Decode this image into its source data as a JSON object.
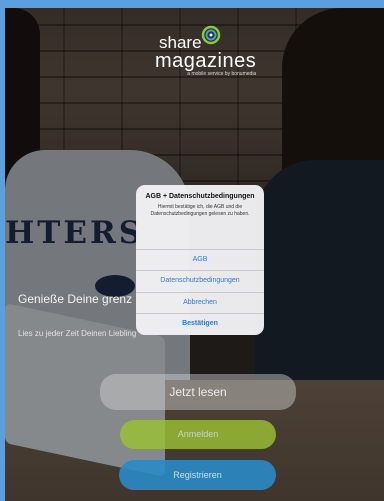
{
  "app": {
    "logo_share": "share",
    "logo_magazines": "magazines",
    "logo_sub": "a mobile service by bonumedia"
  },
  "background": {
    "tagline": "Genieße Deine grenz",
    "subline": "Lies zu jeder Zeit Deinen Liebling",
    "shirt_print": "HTERS"
  },
  "buttons": {
    "read_now": "Jetzt lesen",
    "login": "Anmelden",
    "register": "Registrieren"
  },
  "dialog": {
    "title": "AGB + Datenschutzbedingungen",
    "message": "Hiermit bestätige ich, die AGB und die Datenschutzbedingungen gelesen zu haben.",
    "actions": [
      "AGB",
      "Datenschutzbedingungen",
      "Abbrechen",
      "Bestätigen"
    ]
  },
  "colors": {
    "accent_blue": "#2a7bd5",
    "login_green": "#9cc334",
    "register_blue": "#2a8bc6"
  }
}
